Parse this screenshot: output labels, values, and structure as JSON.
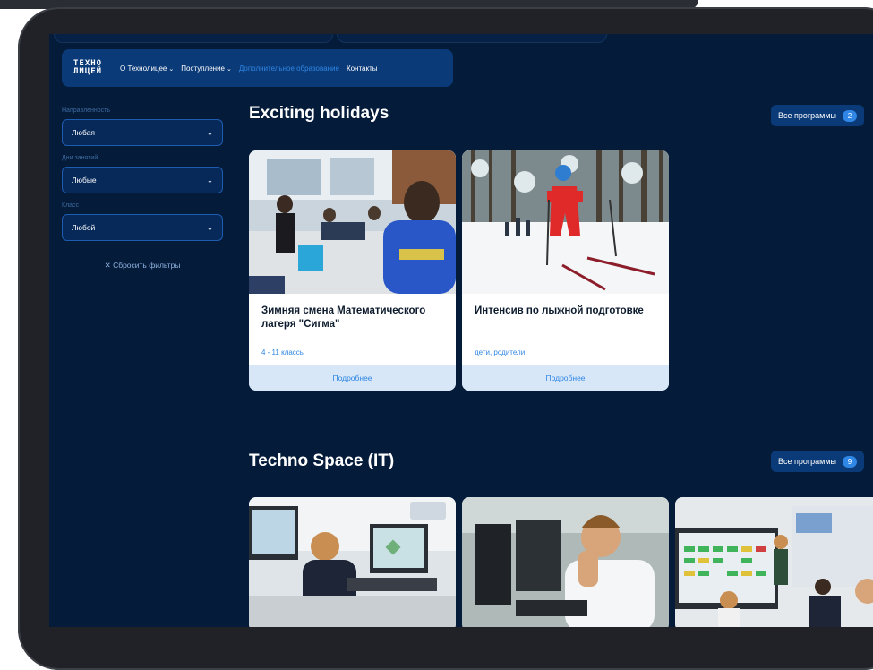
{
  "nav": {
    "logo_line1": "ТЕХНО",
    "logo_line2": "ЛИЦЕЙ",
    "items": [
      {
        "label": "О Технолицее",
        "chevron": true
      },
      {
        "label": "Поступление",
        "chevron": true
      },
      {
        "label": "Дополнительное образование",
        "active": true
      },
      {
        "label": "Контакты"
      }
    ]
  },
  "filters": [
    {
      "label": "Направленность",
      "value": "Любая"
    },
    {
      "label": "Дни занятий",
      "value": "Любые"
    },
    {
      "label": "Класс",
      "value": "Любой"
    }
  ],
  "reset_label": "Сбросить фильтры",
  "sections": [
    {
      "title": "Exciting holidays",
      "all_label": "Все программы",
      "count": "2",
      "cards": [
        {
          "title": "Зимняя смена Математического лагеря \"Сигма\"",
          "tag": "4 - 11 классы",
          "button": "Подробнее"
        },
        {
          "title": "Интенсив по лыжной подготовке",
          "tag": "дети, родители",
          "button": "Подробнее"
        }
      ]
    },
    {
      "title": "Techno Space (IT)",
      "all_label": "Все программы",
      "count": "9"
    }
  ],
  "colors": {
    "background": "#041b3a",
    "navbar": "#0b3a78",
    "accent": "#2f86e4",
    "card_button": "#d7e7f8"
  },
  "icons": {
    "chevron": "chevron-down-icon",
    "reset": "close-icon"
  }
}
